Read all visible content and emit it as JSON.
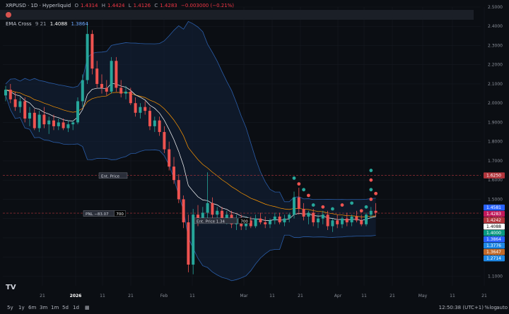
{
  "symbol_line": {
    "symbol": "XRPUSD · 1D · Hyperliquid",
    "o_label": "O",
    "o": "1.4314",
    "h_label": "H",
    "h": "1.4424",
    "l_label": "L",
    "l": "1.4126",
    "c_label": "C",
    "c": "1.4283",
    "change": "−0.003000 (−0.21%)"
  },
  "indicator_line": {
    "name": "EMA Cross",
    "params": "9 21",
    "v1": "1.4088",
    "v2": "1.3864"
  },
  "lines": {
    "entry_label": "Ent. Price",
    "pnl_label": "PNL  −83.07",
    "pnl_qty": "700",
    "entry2_label": "Ent. Price  1.34",
    "entry2_qty": "700"
  },
  "price_badges": [
    {
      "text": "1.6250",
      "bg": "#b2353c",
      "fg": "#ffffff"
    },
    {
      "text": "1.4581",
      "bg": "#2962ff",
      "fg": "#ffffff"
    },
    {
      "text": "1.4283",
      "bg": "#c2185b",
      "fg": "#ffffff"
    },
    {
      "text": "1.4242",
      "bg": "#b2353c",
      "fg": "#ffffff"
    },
    {
      "text": "1.4088",
      "bg": "#ffffff",
      "fg": "#000000"
    },
    {
      "text": "1.4000",
      "bg": "#089981",
      "fg": "#ffffff"
    },
    {
      "text": "1.3864",
      "bg": "#2962ff",
      "fg": "#ffffff"
    },
    {
      "text": "1.3776",
      "bg": "#1e88e5",
      "fg": "#ffffff"
    },
    {
      "text": "1.3647",
      "bg": "#c26a2a",
      "fg": "#ffffff"
    },
    {
      "text": "1.2714",
      "bg": "#1e88e5",
      "fg": "#ffffff"
    }
  ],
  "toolbar": {
    "timeframes": [
      "5y",
      "1y",
      "6m",
      "3m",
      "1m",
      "5d",
      "1d"
    ],
    "time": "12:50:38 (UTC+1)",
    "pct": "%",
    "log": "log",
    "auto": "auto"
  },
  "colors": {
    "up": "#26a69a",
    "down": "#ef5350",
    "band": "#2a5da8",
    "ema_fast": "#ffffff",
    "ema_slow": "#ff9800"
  },
  "chart_data": {
    "type": "candlestick",
    "ylim": [
      1.05,
      2.5
    ],
    "y_ticks": [
      2.5,
      2.4,
      2.3,
      2.2,
      2.1,
      2.0,
      1.9,
      1.8,
      1.7,
      1.6,
      1.5,
      1.4,
      1.3,
      1.2,
      1.1
    ],
    "x_tick_labels": [
      "21",
      "2026",
      "11",
      "21",
      "Feb",
      "11",
      "Mar",
      "11",
      "21",
      "Apr",
      "11",
      "21",
      "May",
      "11",
      "21"
    ],
    "candles": [
      [
        2.04,
        2.09,
        2.01,
        2.07
      ],
      [
        2.07,
        2.1,
        2.0,
        2.02
      ],
      [
        2.02,
        2.06,
        1.96,
        1.98
      ],
      [
        1.98,
        2.03,
        1.95,
        2.01
      ],
      [
        2.01,
        2.03,
        1.9,
        1.92
      ],
      [
        1.92,
        1.98,
        1.88,
        1.95
      ],
      [
        1.95,
        1.97,
        1.86,
        1.87
      ],
      [
        1.87,
        1.96,
        1.85,
        1.94
      ],
      [
        1.94,
        1.98,
        1.87,
        1.89
      ],
      [
        1.89,
        1.93,
        1.84,
        1.91
      ],
      [
        1.91,
        1.94,
        1.86,
        1.88
      ],
      [
        1.88,
        1.92,
        1.86,
        1.9
      ],
      [
        1.9,
        1.92,
        1.86,
        1.87
      ],
      [
        1.87,
        1.91,
        1.85,
        1.89
      ],
      [
        1.89,
        1.91,
        1.86,
        1.9
      ],
      [
        1.9,
        2.03,
        1.89,
        2.01
      ],
      [
        2.01,
        2.15,
        1.98,
        2.12
      ],
      [
        2.12,
        2.42,
        2.1,
        2.36
      ],
      [
        2.36,
        2.38,
        2.15,
        2.18
      ],
      [
        2.18,
        2.22,
        2.08,
        2.1
      ],
      [
        2.1,
        2.15,
        2.05,
        2.08
      ],
      [
        2.08,
        2.12,
        2.04,
        2.06
      ],
      [
        2.06,
        2.24,
        2.05,
        2.22
      ],
      [
        2.22,
        2.24,
        2.06,
        2.08
      ],
      [
        2.08,
        2.12,
        2.03,
        2.05
      ],
      [
        2.05,
        2.09,
        2.02,
        2.06
      ],
      [
        2.06,
        2.08,
        1.99,
        2.0
      ],
      [
        2.0,
        2.03,
        1.93,
        1.95
      ],
      [
        1.95,
        2.0,
        1.92,
        1.98
      ],
      [
        1.98,
        2.01,
        1.94,
        1.96
      ],
      [
        1.96,
        1.98,
        1.86,
        1.88
      ],
      [
        1.88,
        1.93,
        1.85,
        1.91
      ],
      [
        1.91,
        1.93,
        1.83,
        1.85
      ],
      [
        1.85,
        1.88,
        1.74,
        1.76
      ],
      [
        1.76,
        1.8,
        1.65,
        1.67
      ],
      [
        1.67,
        1.72,
        1.58,
        1.6
      ],
      [
        1.6,
        1.63,
        1.48,
        1.5
      ],
      [
        1.5,
        1.52,
        1.35,
        1.38
      ],
      [
        1.38,
        1.42,
        1.12,
        1.16
      ],
      [
        1.16,
        1.45,
        1.11,
        1.42
      ],
      [
        1.42,
        1.47,
        1.36,
        1.4
      ],
      [
        1.4,
        1.46,
        1.38,
        1.43
      ],
      [
        1.43,
        1.64,
        1.4,
        1.48
      ],
      [
        1.48,
        1.51,
        1.4,
        1.42
      ],
      [
        1.42,
        1.46,
        1.39,
        1.44
      ],
      [
        1.44,
        1.46,
        1.38,
        1.39
      ],
      [
        1.39,
        1.44,
        1.37,
        1.42
      ],
      [
        1.42,
        1.44,
        1.35,
        1.37
      ],
      [
        1.37,
        1.42,
        1.34,
        1.4
      ],
      [
        1.4,
        1.42,
        1.34,
        1.36
      ],
      [
        1.36,
        1.41,
        1.34,
        1.39
      ],
      [
        1.39,
        1.41,
        1.35,
        1.36
      ],
      [
        1.36,
        1.42,
        1.35,
        1.4
      ],
      [
        1.4,
        1.43,
        1.37,
        1.38
      ],
      [
        1.38,
        1.41,
        1.35,
        1.37
      ],
      [
        1.37,
        1.4,
        1.35,
        1.39
      ],
      [
        1.39,
        1.43,
        1.37,
        1.41
      ],
      [
        1.41,
        1.43,
        1.37,
        1.38
      ],
      [
        1.38,
        1.42,
        1.36,
        1.4
      ],
      [
        1.4,
        1.43,
        1.38,
        1.42
      ],
      [
        1.42,
        1.54,
        1.4,
        1.51
      ],
      [
        1.51,
        1.56,
        1.42,
        1.45
      ],
      [
        1.45,
        1.48,
        1.39,
        1.41
      ],
      [
        1.41,
        1.44,
        1.37,
        1.43
      ],
      [
        1.43,
        1.45,
        1.36,
        1.38
      ],
      [
        1.38,
        1.42,
        1.35,
        1.4
      ],
      [
        1.4,
        1.44,
        1.37,
        1.42
      ],
      [
        1.42,
        1.44,
        1.34,
        1.36
      ],
      [
        1.36,
        1.4,
        1.33,
        1.39
      ],
      [
        1.39,
        1.42,
        1.35,
        1.37
      ],
      [
        1.37,
        1.41,
        1.35,
        1.4
      ],
      [
        1.4,
        1.43,
        1.36,
        1.38
      ],
      [
        1.38,
        1.42,
        1.36,
        1.41
      ],
      [
        1.41,
        1.44,
        1.38,
        1.39
      ],
      [
        1.39,
        1.42,
        1.36,
        1.37
      ],
      [
        1.37,
        1.43,
        1.36,
        1.42
      ],
      [
        1.42,
        1.46,
        1.4,
        1.44
      ],
      [
        1.44,
        1.48,
        1.41,
        1.43
      ]
    ]
  }
}
